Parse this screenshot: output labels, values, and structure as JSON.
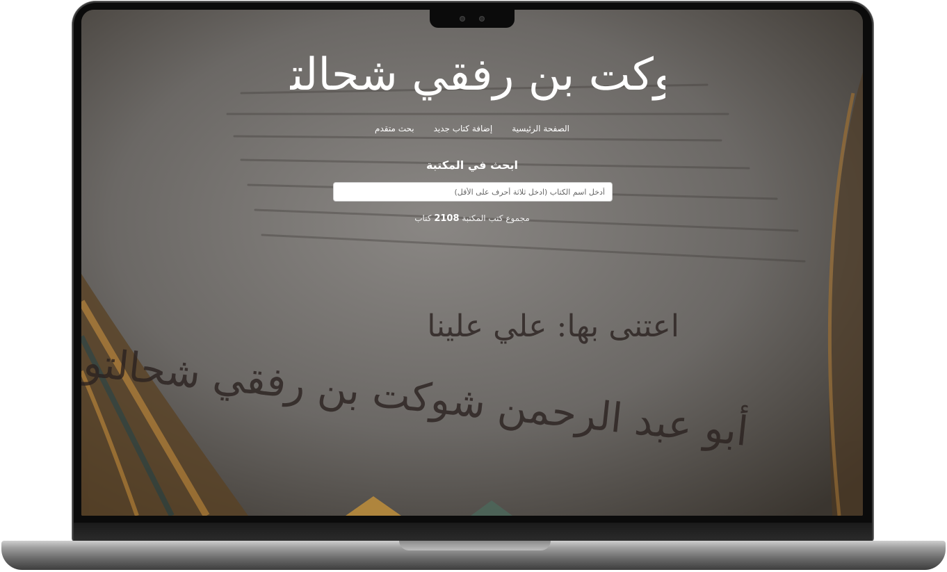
{
  "site": {
    "logo_text": "شوكت بن رفقي شحالتوغ",
    "nav": {
      "home": "الصفحة الرئيسية",
      "add_book": "إضافة كتاب جديد",
      "advanced_search": "بحث متقدم"
    },
    "search": {
      "title": "ابحث في المكتبة",
      "placeholder": "أدخل اسم الكتاب (ادخل ثلاثة أحرف على الأقل)"
    },
    "stats": {
      "prefix": "مجموع كتب المكتبة",
      "count": "2108",
      "suffix": "كتاب"
    }
  },
  "background": {
    "calligraphy_line_1": "اعتنى بها: علي علينا",
    "calligraphy_line_2": "أبو عبد الرحمن شوكت بن رفقي شحالتوغ"
  },
  "colors": {
    "overlay": "#6f6c69",
    "text": "#ffffff",
    "ornament": "#8c5f28"
  }
}
